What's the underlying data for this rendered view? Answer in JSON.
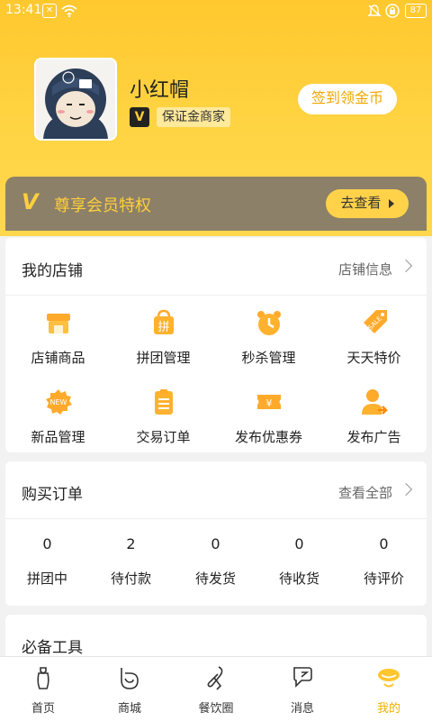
{
  "status_bar": {
    "time": "13:41",
    "battery": "87"
  },
  "profile": {
    "name": "小红帽",
    "badge": "V",
    "merchant_label": "保证金商家",
    "signin_label": "签到领金币"
  },
  "member": {
    "logo": "V",
    "text": "尊享会员特权",
    "button": "去查看"
  },
  "shop": {
    "title": "我的店铺",
    "more": "店铺信息",
    "items": [
      {
        "label": "店铺商品",
        "icon": "store-icon"
      },
      {
        "label": "拼团管理",
        "icon": "group-buy-icon"
      },
      {
        "label": "秒杀管理",
        "icon": "alarm-clock-icon"
      },
      {
        "label": "天天特价",
        "icon": "sale-tag-icon"
      },
      {
        "label": "新品管理",
        "icon": "new-badge-icon"
      },
      {
        "label": "交易订单",
        "icon": "clipboard-icon"
      },
      {
        "label": "发布优惠券",
        "icon": "coupon-icon"
      },
      {
        "label": "发布广告",
        "icon": "user-share-icon"
      }
    ]
  },
  "orders": {
    "title": "购买订单",
    "more": "查看全部",
    "items": [
      {
        "count": "0",
        "label": "拼团中"
      },
      {
        "count": "2",
        "label": "待付款"
      },
      {
        "count": "0",
        "label": "待发货"
      },
      {
        "count": "0",
        "label": "待收货"
      },
      {
        "count": "0",
        "label": "待评价"
      }
    ]
  },
  "tools": {
    "title": "必备工具"
  },
  "nav": {
    "items": [
      {
        "label": "首页",
        "icon": "home-icon"
      },
      {
        "label": "商城",
        "icon": "mall-icon"
      },
      {
        "label": "餐饮圈",
        "icon": "dining-icon"
      },
      {
        "label": "消息",
        "icon": "message-icon"
      },
      {
        "label": "我的",
        "icon": "profile-icon"
      }
    ],
    "active_index": 4
  },
  "colors": {
    "accent": "#ffcc33",
    "member_bg": "#8c8068",
    "active": "#f0b000"
  }
}
